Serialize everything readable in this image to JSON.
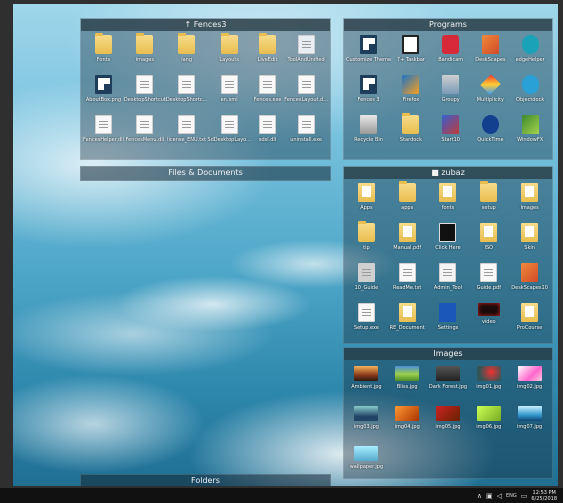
{
  "fences": {
    "fences3": {
      "title": "Fences3",
      "items": [
        {
          "label": "Fonts",
          "type": "folder"
        },
        {
          "label": "images",
          "type": "folder"
        },
        {
          "label": "lang",
          "type": "folder"
        },
        {
          "label": "Layouts",
          "type": "folder"
        },
        {
          "label": "LiveEdit",
          "type": "folder"
        },
        {
          "label": "ToolAndUnified",
          "type": "img"
        },
        {
          "label": "AboutBox.png",
          "type": "app"
        },
        {
          "label": "DesktopShortcut",
          "type": "doc"
        },
        {
          "label": "DesktopShortc...",
          "type": "doc"
        },
        {
          "label": "en.xml",
          "type": "doc"
        },
        {
          "label": "Fences.exe",
          "type": "doc"
        },
        {
          "label": "FencesLayout.d...",
          "type": "doc"
        },
        {
          "label": "FencesHelper.dll",
          "type": "doc"
        },
        {
          "label": "FencesMenu.dll",
          "type": "doc"
        },
        {
          "label": "license_ENU.txt",
          "type": "doc"
        },
        {
          "label": "SdDesktopLayo...",
          "type": "doc"
        },
        {
          "label": "sdsl.dll",
          "type": "doc"
        },
        {
          "label": "uninstall.exe",
          "type": "doc"
        }
      ]
    },
    "programs": {
      "title": "Programs",
      "items": [
        {
          "label": "Customize Theme",
          "type": "app-dark"
        },
        {
          "label": "7+ Taskbar",
          "type": "app-7"
        },
        {
          "label": "Bandicam",
          "type": "app-red"
        },
        {
          "label": "DeskScapes",
          "type": "app-orange"
        },
        {
          "label": "edgeHelper",
          "type": "app-edge"
        },
        {
          "label": "Fences 3",
          "type": "app-dark"
        },
        {
          "label": "Firefox",
          "type": "app-ff"
        },
        {
          "label": "Groupy",
          "type": "app-groupy"
        },
        {
          "label": "Multiplicity",
          "type": "app-cube"
        },
        {
          "label": "Objectdock",
          "type": "app-dock"
        },
        {
          "label": "Recycle Bin",
          "type": "app-bin"
        },
        {
          "label": "Stardock",
          "type": "folder"
        },
        {
          "label": "Start10",
          "type": "app-start"
        },
        {
          "label": "QuickTime",
          "type": "app-q"
        },
        {
          "label": "WindowFX",
          "type": "app-fx"
        }
      ]
    },
    "files": {
      "title": "Files & Documents"
    },
    "zubaz": {
      "title": "zubaz",
      "items": [
        {
          "label": "Apps",
          "type": "folder-doc"
        },
        {
          "label": "apps",
          "type": "folder"
        },
        {
          "label": "fonts",
          "type": "folder-doc"
        },
        {
          "label": "setup",
          "type": "folder"
        },
        {
          "label": "Images",
          "type": "folder-doc"
        },
        {
          "label": "tip",
          "type": "folder"
        },
        {
          "label": "Manual.pdf",
          "type": "folder-doc"
        },
        {
          "label": "Click Here",
          "type": "app-black"
        },
        {
          "label": "ISO",
          "type": "folder-doc"
        },
        {
          "label": "Skin",
          "type": "folder-doc"
        },
        {
          "label": "10_Guide",
          "type": "doc-gray"
        },
        {
          "label": "ReadMe.txt",
          "type": "doc"
        },
        {
          "label": "Admin_Tool",
          "type": "app-sig"
        },
        {
          "label": "Guide.pdf",
          "type": "doc"
        },
        {
          "label": "DeskScapes10",
          "type": "app-orange"
        },
        {
          "label": "Setup.exe",
          "type": "doc"
        },
        {
          "label": "RE_Document",
          "type": "folder-doc"
        },
        {
          "label": "Settings",
          "type": "app-blue"
        },
        {
          "label": "video",
          "type": "app-video"
        },
        {
          "label": "ProCourse",
          "type": "folder-doc"
        }
      ]
    },
    "images": {
      "title": "Images",
      "items": [
        {
          "label": "Ambient.jpg",
          "type": "img-sunset"
        },
        {
          "label": "Bliss.jpg",
          "type": "img-green"
        },
        {
          "label": "Dark Forest.jpg",
          "type": "img-dark"
        },
        {
          "label": "img01.jpg",
          "type": "img-flower"
        },
        {
          "label": "img02.jpg",
          "type": "img-pink"
        },
        {
          "label": "img03.jpg",
          "type": "img-sea"
        },
        {
          "label": "img04.jpg",
          "type": "img-orange"
        },
        {
          "label": "img05.jpg",
          "type": "img-red"
        },
        {
          "label": "img06.jpg",
          "type": "img-lime"
        },
        {
          "label": "img07.jpg",
          "type": "img-ocean"
        },
        {
          "label": "wallpaper.jpg",
          "type": "img-sky"
        }
      ]
    },
    "folders": {
      "title": "Folders"
    }
  },
  "taskbar": {
    "time": "12:53 PM",
    "date": "6/25/2018",
    "tray_icons": [
      "chevron-up-icon",
      "network-icon",
      "volume-icon",
      "keyboard-icon",
      "message-icon"
    ],
    "lang": "ENG"
  },
  "colors": {
    "fence_title_bg": "#34505a",
    "taskbar_bg": "#111111"
  }
}
